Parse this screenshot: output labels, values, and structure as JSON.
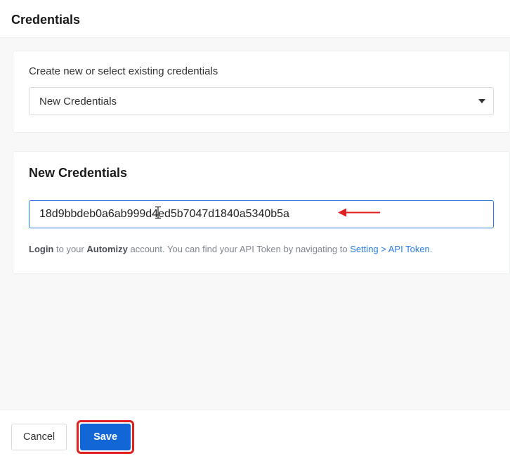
{
  "header": {
    "title": "Credentials"
  },
  "selectCard": {
    "label": "Create new or select existing credentials",
    "selectedValue": "New Credentials"
  },
  "newCredCard": {
    "title": "New Credentials",
    "tokenValue": "18d9bbdeb0a6ab999d4ed5b7047d1840a5340b5a",
    "help": {
      "login": "Login",
      "mid1": " to your ",
      "brand": "Automizy",
      "mid2": " account. You can find your API Token by navigating to ",
      "linkText": "Setting > API Token",
      "tail": "."
    }
  },
  "footer": {
    "cancel": "Cancel",
    "save": "Save"
  },
  "annotations": {
    "arrowColor": "#e02020",
    "highlightColor": "#e02020"
  }
}
